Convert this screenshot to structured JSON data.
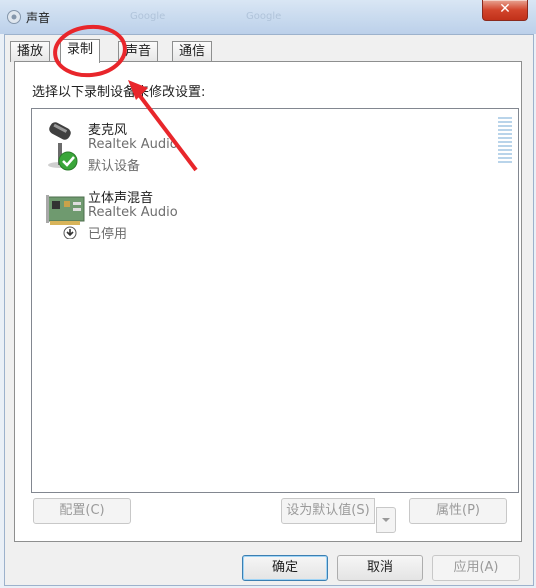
{
  "window": {
    "title": "声音",
    "close_glyph": "✕",
    "background_ghost_text": [
      "Google",
      "Google"
    ]
  },
  "tabs": [
    {
      "label": "播放",
      "active": false
    },
    {
      "label": "录制",
      "active": true
    },
    {
      "label": "声音",
      "active": false
    },
    {
      "label": "通信",
      "active": false
    }
  ],
  "instruction": "选择以下录制设备来修改设置:",
  "devices": [
    {
      "name": "麦克风",
      "driver": "Realtek Audio",
      "status": "默认设备",
      "icon": "microphone-icon",
      "badge": "green-check-icon"
    },
    {
      "name": "立体声混音",
      "driver": "Realtek Audio",
      "status": "已停用",
      "icon": "sound-card-icon",
      "badge": "disabled-arrow-icon"
    }
  ],
  "buttons": {
    "configure": "配置(C)",
    "set_default": "设为默认值(S)",
    "properties": "属性(P)",
    "ok": "确定",
    "cancel": "取消",
    "apply": "应用(A)"
  },
  "colors": {
    "annotation": "#e8262b",
    "check_badge": "#3aa63a",
    "level_meter": "#b9d4ea"
  }
}
